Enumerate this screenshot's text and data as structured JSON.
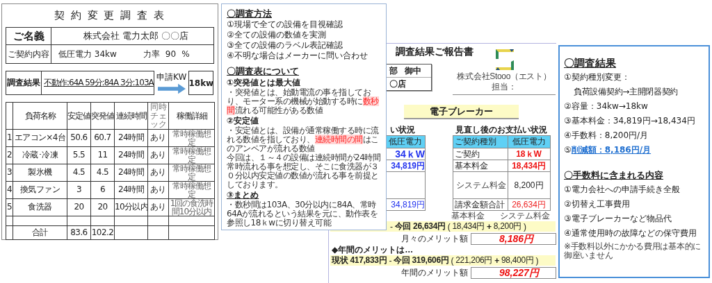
{
  "survey_sheet": {
    "title": "契 約 変 更 調 査 表",
    "customer": {
      "label": "ご名義",
      "value": "株式会社  電力太郎  〇〇店"
    },
    "contract": {
      "label": "ご契約内容",
      "value": "低圧電力  34kw",
      "factor_label": "力率",
      "factor": "90",
      "factor_unit": "%"
    },
    "result": {
      "label": "調査結果",
      "value": "不動作:64A  59分:84A  3分:103A"
    },
    "apply": {
      "label": "申請KW",
      "value": "18kw"
    },
    "table": {
      "columns": [
        "負荷名称",
        "安定値",
        "突発値",
        "連続時間",
        "同時チェック",
        "稼働詳細"
      ],
      "rows": [
        {
          "no": "1",
          "name": "エアコン×4台",
          "stable": "50.6",
          "peak": "60.7",
          "duration": "24時間",
          "check": "あり",
          "detail": "常時稼働想定"
        },
        {
          "no": "2",
          "name": "冷蔵･冷凍",
          "stable": "5.5",
          "peak": "11",
          "duration": "24時間",
          "check": "あり",
          "detail": "常時稼働想定"
        },
        {
          "no": "3",
          "name": "製氷機",
          "stable": "4.5",
          "peak": "4.5",
          "duration": "24時間",
          "check": "あり",
          "detail": "常時稼働想定"
        },
        {
          "no": "4",
          "name": "換気ファン",
          "stable": "3",
          "peak": "6",
          "duration": "24時間",
          "check": "あり",
          "detail": "常時稼働想定"
        },
        {
          "no": "5",
          "name": "食洗器",
          "stable": "20",
          "peak": "20",
          "duration": "10分以内",
          "check": "あり",
          "detail": "1回の食洗時間10分以内"
        }
      ],
      "total": {
        "label": "合計",
        "stable": "83.6",
        "peak": "102.2"
      }
    }
  },
  "method_panel": {
    "heading": "〇調査方法",
    "steps": [
      "①現場で全ての設備を目視確認",
      "②全ての設備の数値を実測",
      "③全ての設備のラベル表記確認",
      "④不明な場合はメーカーに問い合わせ"
    ],
    "heading2": "〇調査表について",
    "sections": [
      {
        "title": "①突発値とは最大値",
        "paragraphs": [
          [
            {
              "text": "・突発値とは、始動電流の事を指しており、モーター系の機械が始動する時に",
              "highlight": false
            },
            {
              "text": "数秒間",
              "highlight": true
            },
            {
              "text": "流れる可能性がある数値",
              "highlight": false
            }
          ]
        ]
      },
      {
        "title": "②安定値",
        "paragraphs": [
          [
            {
              "text": "・安定値とは、設備が通常稼働する時に流れる数値を指しており、",
              "highlight": false
            },
            {
              "text": "連続時間の間",
              "highlight": true
            },
            {
              "text": "はこのアンペアが流れる数値",
              "highlight": false
            }
          ],
          [
            {
              "text": "今回は、１～４の設備は連続時間が24時間常時流れる事を想定し、そこに食洗器が３０分以内安定値の数値が流れる事を前提としております。",
              "highlight": false
            }
          ]
        ]
      },
      {
        "title": "③まとめ",
        "paragraphs": [
          [
            {
              "text": "・数秒間は103A、30分以内に84A、常時64Aが流れるという結果を元に、動作表を参照し18ｋwに切り替え可能",
              "highlight": false
            }
          ]
        ]
      }
    ]
  },
  "report": {
    "title": "調査結果ご報告書",
    "addressee": {
      "name_end": "部",
      "honorific": "御中",
      "store": "〇店"
    },
    "company": "株式会社Stooo（エスト）",
    "staff_label": "担当：",
    "banner": "電子ブレーカー",
    "current": {
      "heading": "い状況",
      "plan": "低圧電力",
      "contract": "34ｋW",
      "base": "34,819円",
      "total": "34,819円"
    },
    "revised": {
      "heading": "見直し後のお支払い状況",
      "rows": [
        {
          "label": "ご契約種別",
          "value": "低圧電力",
          "kind": "header"
        },
        {
          "label": "ご契約",
          "value": "18ｋW",
          "kind": "strong"
        },
        {
          "label": "基本料金",
          "value": "18,434円",
          "kind": "strong"
        },
        {
          "label": "システム料金",
          "value": "8,200円",
          "kind": "tall"
        },
        {
          "label": "請求金額合計",
          "value": "26,634円",
          "kind": "total"
        }
      ]
    },
    "breakdown_labels": [
      "基本料金",
      "システム料金"
    ],
    "monthly": {
      "minus": "-",
      "new_label": "今回",
      "new": "26,634円",
      "open": "(",
      "base": "18,434円",
      "plus": "+",
      "system": "8,200円",
      "close": ")",
      "merit_label": "月々のメリット額",
      "merit": "8,186円"
    },
    "annual_heading": "◆年間のメリットは…",
    "annual": {
      "current_label": "現状",
      "current": "417,833円",
      "minus": "-",
      "new_label": "今回",
      "new": "319,606円",
      "open": "(",
      "base": "221,206円",
      "plus": "+",
      "system": "98,400円",
      "close": ")",
      "merit_label": "年間のメリット額",
      "merit": "98,227円"
    }
  },
  "results_panel": {
    "heading": "〇調査結果",
    "items": [
      {
        "text": "①契約種別変更：",
        "detail": "負荷設備契約→主開閉器契約",
        "emphasis": false
      },
      {
        "text": "②容量：34kw→18kw",
        "emphasis": false
      },
      {
        "text": "③基本料金：34,819円→18,434円",
        "emphasis": false
      },
      {
        "text": "④手数料：8,200円/月",
        "emphasis": false
      },
      {
        "mark": "⑤",
        "text": "削減額：8,186円/月",
        "emphasis": true
      }
    ],
    "fee_heading": "〇手数料に含まれる内容",
    "fee_items": [
      "①電力会社への申請手続き全般",
      "②切替え工事費用",
      "③電子ブレーカーなど物品代",
      "④通常使用時の故障などの保守費用"
    ],
    "note": "※手数料以外にかかる費用は基本的に御座いません"
  }
}
